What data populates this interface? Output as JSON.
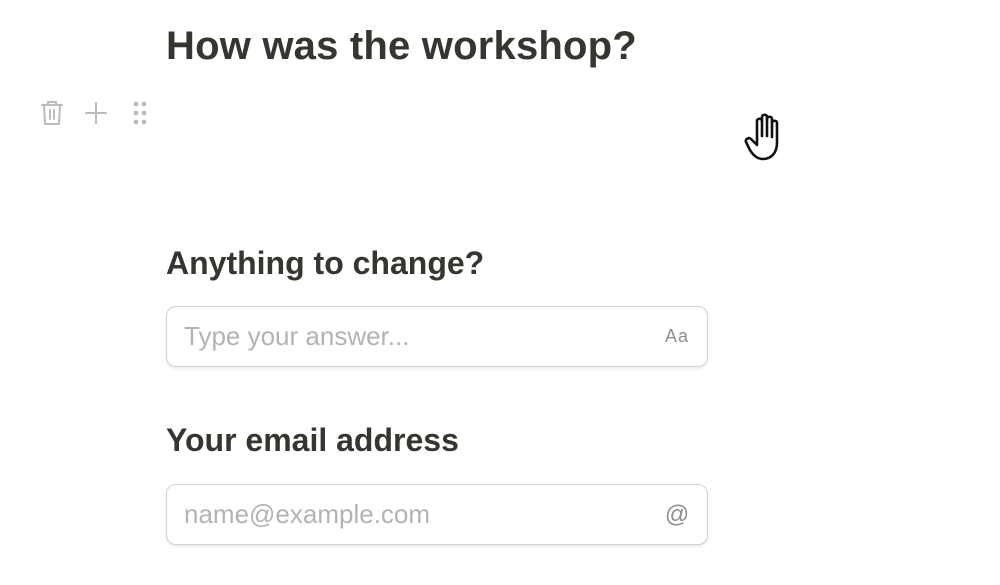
{
  "form": {
    "title": "How was the workshop?",
    "questions": [
      {
        "label": "Anything to change?",
        "placeholder": "Type your answer...",
        "value": "",
        "type_icon": "text-type-icon",
        "type_icon_glyph": "Aa"
      },
      {
        "label": "Your email address",
        "placeholder": "name@example.com",
        "value": "",
        "type_icon": "at-sign-icon",
        "type_icon_glyph": "@"
      }
    ]
  },
  "block_toolbar": {
    "icons": [
      "trash-icon",
      "plus-icon",
      "drag-handle-icon"
    ]
  },
  "cursor": {
    "icon": "hand-pointer-cursor-icon"
  },
  "colors": {
    "text": "#37352f",
    "muted_icon": "#bdbcb8",
    "placeholder": "#b4b3af",
    "border": "#d3d1cb"
  }
}
